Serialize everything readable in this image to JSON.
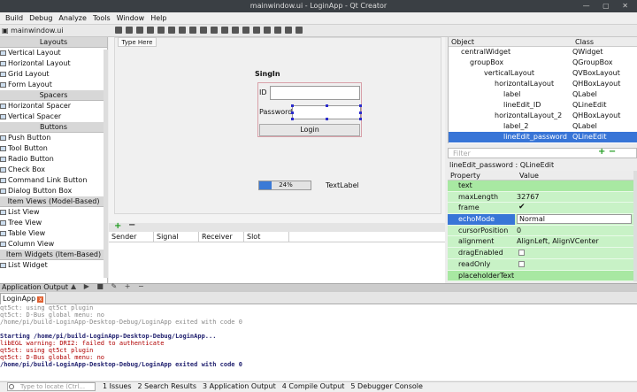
{
  "window": {
    "title": "mainwindow.ui - LoginApp - Qt Creator"
  },
  "menu": [
    "Build",
    "Debug",
    "Analyze",
    "Tools",
    "Window",
    "Help"
  ],
  "editor": {
    "file_title": "mainwindow.ui"
  },
  "widget_box": {
    "sections": [
      {
        "category": "Layouts",
        "items": [
          "Vertical Layout",
          "Horizontal Layout",
          "Grid Layout",
          "Form Layout"
        ]
      },
      {
        "category": "Spacers",
        "items": [
          "Horizontal Spacer",
          "Vertical Spacer"
        ]
      },
      {
        "category": "Buttons",
        "items": [
          "Push Button",
          "Tool Button",
          "Radio Button",
          "Check Box",
          "Command Link Button",
          "Dialog Button Box"
        ]
      },
      {
        "category": "Item Views (Model-Based)",
        "items": [
          "List View",
          "Tree View",
          "Table View",
          "Column View"
        ]
      },
      {
        "category": "Item Widgets (Item-Based)",
        "items": [
          "List Widget"
        ]
      }
    ]
  },
  "form": {
    "type_here": "Type Here",
    "signin_label": "SingIn",
    "id_label": "ID",
    "password_label": "Password",
    "login_button": "Login",
    "progress_value": 24,
    "progress_text": "24%",
    "text_label": "TextLabel"
  },
  "signals_slots": {
    "columns": [
      "Sender",
      "Signal",
      "Receiver",
      "Slot"
    ]
  },
  "object_inspector": {
    "col_object": "Object",
    "col_class": "Class",
    "rows": [
      {
        "object": "centralWidget",
        "class": "QWidget",
        "indent": 14
      },
      {
        "object": "groupBox",
        "class": "QGroupBox",
        "indent": 24
      },
      {
        "object": "verticalLayout",
        "class": "QVBoxLayout",
        "indent": 40
      },
      {
        "object": "horizontalLayout",
        "class": "QHBoxLayout",
        "indent": 52
      },
      {
        "object": "label",
        "class": "QLabel",
        "indent": 62
      },
      {
        "object": "lineEdit_ID",
        "class": "QLineEdit",
        "indent": 62
      },
      {
        "object": "horizontalLayout_2",
        "class": "QHBoxLayout",
        "indent": 52
      },
      {
        "object": "label_2",
        "class": "QLabel",
        "indent": 62
      },
      {
        "object": "lineEdit_password",
        "class": "QLineEdit",
        "indent": 62,
        "selected": true
      }
    ]
  },
  "property_editor": {
    "filter_placeholder": "Filter",
    "header": "lineEdit_password : QLineEdit",
    "col_property": "Property",
    "col_value": "Value",
    "rows": [
      {
        "name": "text",
        "kind": "category"
      },
      {
        "name": "maxLength",
        "value": "32767"
      },
      {
        "name": "frame",
        "check": true
      },
      {
        "name": "echoMode",
        "value": "Normal",
        "combo": true,
        "highlight": true
      },
      {
        "name": "cursorPosition",
        "value": "0"
      },
      {
        "name": "alignment",
        "value": "AlignLeft, AlignVCenter",
        "expand": true
      },
      {
        "name": "dragEnabled",
        "check": false
      },
      {
        "name": "readOnly",
        "check": false
      },
      {
        "name": "placeholderText",
        "kind": "category"
      }
    ]
  },
  "output": {
    "pane_label": "Application Output",
    "tab": "LoginApp",
    "lines": [
      {
        "text": "qt5ct: using qt5ct plugin",
        "style": "g"
      },
      {
        "text": "qt5ct: D-Bus global menu: no",
        "style": "g"
      },
      {
        "text": "/home/pi/build-LoginApp-Desktop-Debug/LoginApp exited with code 0",
        "style": "g"
      },
      {
        "text": "",
        "style": "g"
      },
      {
        "text": "Starting /home/pi/build-LoginApp-Desktop-Debug/LoginApp...",
        "style": "b"
      },
      {
        "text": "libEGL warning: DRI2: failed to authenticate",
        "style": "r"
      },
      {
        "text": "qt5ct: using qt5ct plugin",
        "style": "r"
      },
      {
        "text": "qt5ct: D-Bus global menu: no",
        "style": "r"
      },
      {
        "text": "/home/pi/build-LoginApp-Desktop-Debug/LoginApp exited with code 0",
        "style": "b"
      }
    ]
  },
  "statusbar": {
    "locate_placeholder": "Type to locate (Ctrl...",
    "tabs": [
      "1 Issues",
      "2 Search Results",
      "3 Application Output",
      "4 Compile Output",
      "5 Debugger Console"
    ]
  }
}
